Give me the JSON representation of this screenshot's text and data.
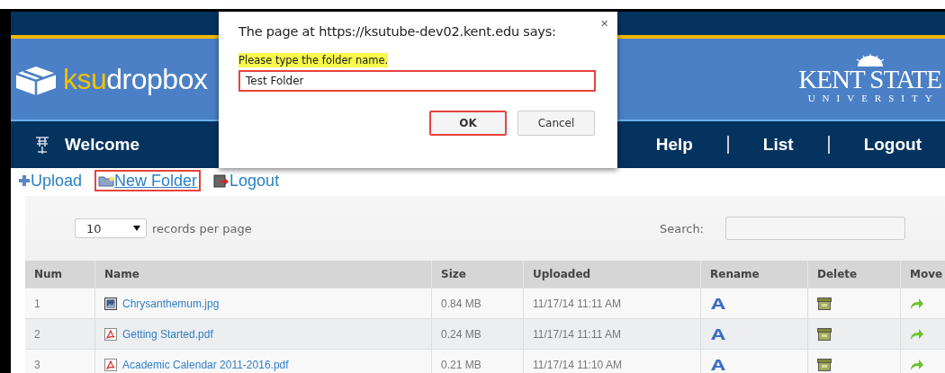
{
  "header": {
    "logo": {
      "prefix": "ksu",
      "name": "dropbox"
    },
    "university": {
      "name": "KENT STATE",
      "subtitle": "UNIVERSITY"
    }
  },
  "nav": {
    "left": {
      "label": "Welcome"
    },
    "right": [
      {
        "label": "Help"
      },
      {
        "label": "List"
      },
      {
        "label": "Logout"
      }
    ]
  },
  "toolbar": [
    {
      "label": "Upload",
      "kind": "upload",
      "highlighted": false
    },
    {
      "label": "New Folder",
      "kind": "folder",
      "highlighted": true
    },
    {
      "label": "Logout",
      "kind": "logout",
      "highlighted": false
    }
  ],
  "controls": {
    "page_size": "10",
    "page_size_label": "records per page",
    "search_label": "Search:"
  },
  "table": {
    "columns": [
      "Num",
      "Name",
      "Size",
      "Uploaded",
      "Rename",
      "Delete",
      "Move"
    ],
    "rows": [
      {
        "num": "1",
        "name": "Chrysanthemum.jpg",
        "kind": "image",
        "size": "0.84 MB",
        "uploaded": "11/17/14 11:11 AM"
      },
      {
        "num": "2",
        "name": "Getting Started.pdf",
        "kind": "pdf",
        "size": "0.24 MB",
        "uploaded": "11/17/14 11:11 AM"
      },
      {
        "num": "3",
        "name": "Academic Calendar 2011-2016.pdf",
        "kind": "pdf",
        "size": "0.21 MB",
        "uploaded": "11/17/14 11:10 AM"
      }
    ]
  },
  "dialog": {
    "title": "The page at https://ksutube-dev02.kent.edu says:",
    "close": "×",
    "message": "Please type the folder name.",
    "value": "Test Folder",
    "input_highlighted": true,
    "buttons": [
      {
        "label": "OK",
        "highlighted": true
      },
      {
        "label": "Cancel",
        "highlighted": false
      }
    ]
  }
}
